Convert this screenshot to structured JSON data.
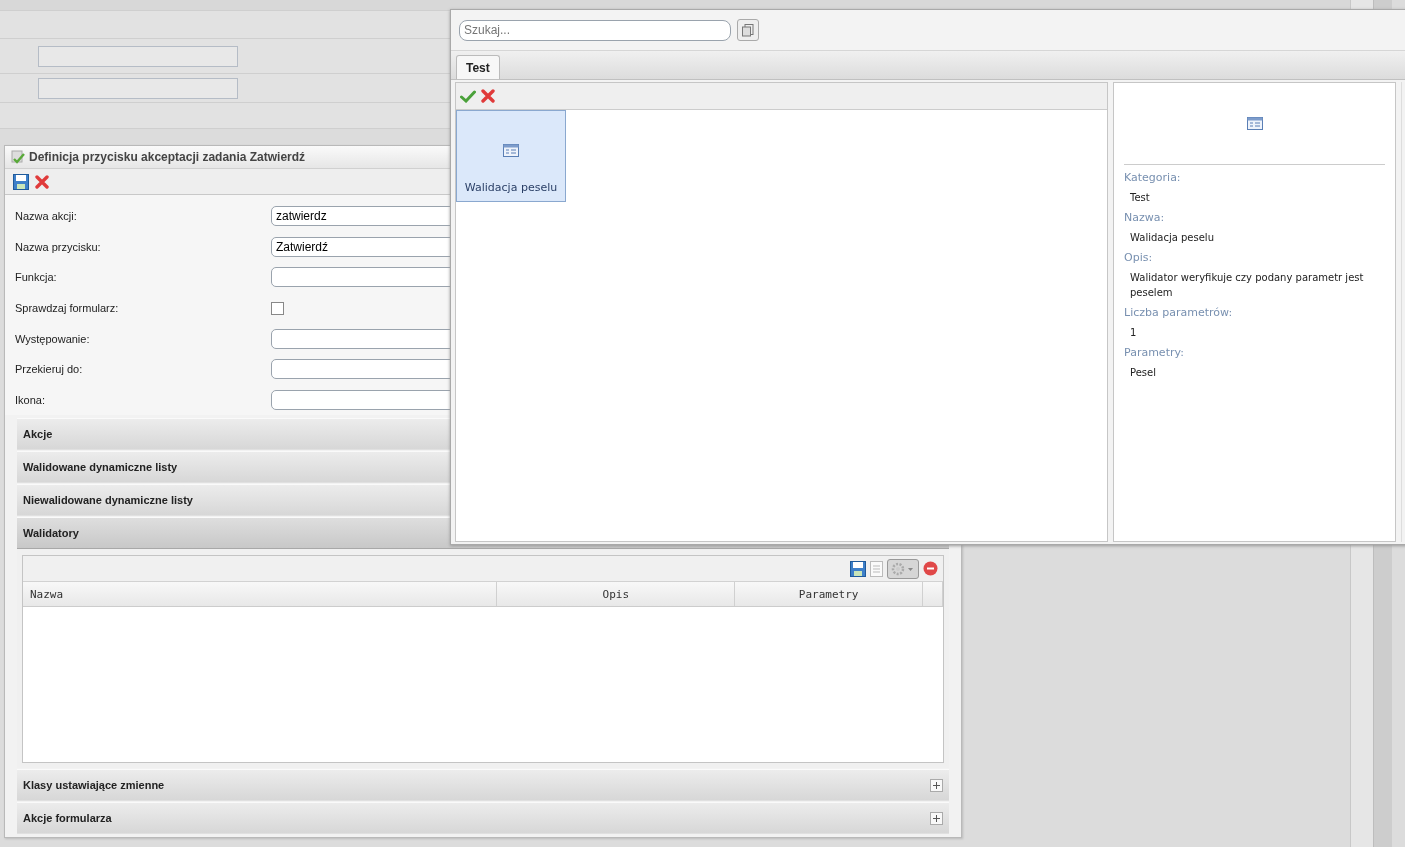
{
  "panel": {
    "title": "Definicja przycisku akceptacji zadania Zatwierdź",
    "fields": [
      {
        "kind": "text",
        "label": "Nazwa akcji:",
        "value": "zatwierdz"
      },
      {
        "kind": "text",
        "label": "Nazwa przycisku:",
        "value": "Zatwierdź"
      },
      {
        "kind": "text",
        "label": "Funkcja:"
      },
      {
        "kind": "checkbox",
        "label": "Sprawdzaj formularz:",
        "checked": false
      },
      {
        "kind": "text",
        "label": "Występowanie:"
      },
      {
        "kind": "text",
        "label": "Przekieruj do:"
      },
      {
        "kind": "text",
        "label": "Ikona:"
      }
    ],
    "sections": [
      {
        "title": "Akcje",
        "expanded": false
      },
      {
        "title": "Walidowane dynamiczne listy",
        "expanded": false
      },
      {
        "title": "Niewalidowane dynamiczne listy",
        "expanded": false
      },
      {
        "title": "Walidatory",
        "expanded": true,
        "columns": [
          "Nazwa",
          "Opis",
          "Parametry"
        ]
      },
      {
        "title": "Klasy ustawiające zmienne",
        "expanded": false,
        "expand_button": true
      },
      {
        "title": "Akcje formularza",
        "expanded": false,
        "expand_button": true
      }
    ]
  },
  "popup": {
    "search": {
      "placeholder": "Szukaj..."
    },
    "tabs": [
      {
        "label": "Test",
        "selected": true
      }
    ],
    "items": [
      {
        "label": "Walidacja peselu",
        "selected": true
      }
    ],
    "details": [
      {
        "label": "Kategoria:",
        "value": "Test"
      },
      {
        "label": "Nazwa:",
        "value": "Walidacja peselu"
      },
      {
        "label": "Opis:",
        "value": "Walidator weryfikuje czy podany parametr jest peselem"
      },
      {
        "label": "Liczba parametrów:",
        "value": "1"
      },
      {
        "label": "Parametry:",
        "value": "Pesel"
      }
    ]
  }
}
